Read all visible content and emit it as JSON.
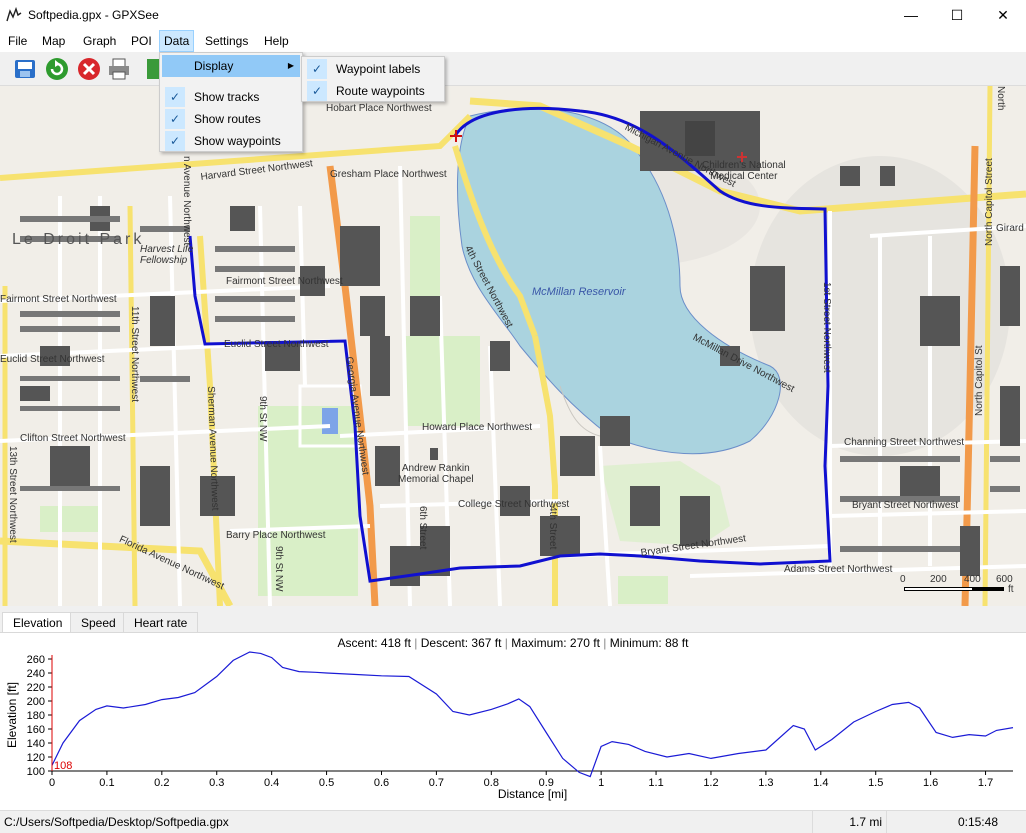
{
  "window": {
    "title": "Softpedia.gpx - GPXSee",
    "minimize": "—",
    "maximize": "☐",
    "close": "✕"
  },
  "menubar": {
    "items": [
      "File",
      "Map",
      "Graph",
      "POI",
      "Data",
      "Settings",
      "Help"
    ]
  },
  "data_menu": {
    "display_label": "Display",
    "items": [
      {
        "label": "Show tracks",
        "checked": true
      },
      {
        "label": "Show routes",
        "checked": true
      },
      {
        "label": "Show waypoints",
        "checked": true
      }
    ]
  },
  "display_submenu": {
    "items": [
      {
        "label": "Waypoint labels",
        "checked": true
      },
      {
        "label": "Route waypoints",
        "checked": true
      }
    ]
  },
  "toolbar": {
    "icons": [
      "open-icon",
      "reload-icon",
      "close-file-icon",
      "print-icon",
      "export-icon"
    ]
  },
  "map": {
    "labels": {
      "reservoir": "McMillan Reservoir",
      "hospital": "Children's National\nMedical Center",
      "chapel": "Andrew Rankin\nMemorial Chapel",
      "fellowship": "Harvest Life\nFellowship",
      "hobart": "Hobart Place Northwest",
      "harvard": "Harvard Street Northwest",
      "gresham": "Gresham Place Northwest",
      "fairmont1": "Fairmont Street Northwest",
      "fairmont2": "Fairmont Street Northwest",
      "euclid1": "Euclid Street Northwest",
      "euclid2": "Euclid Street Northwest",
      "clifton": "Clifton Street Northwest",
      "howard": "Howard Place Northwest",
      "college": "College Street Northwest",
      "barry": "Barry Place Northwest",
      "bryant1": "Bryant Street Northwest",
      "bryant2": "Bryant Street Northwest",
      "adams": "Adams Street Northwest",
      "channing": "Channing Street Northwest",
      "girard": "Girard",
      "florida": "Florida Avenue Northwest",
      "michigan": "Michigan Avenue Northwest",
      "fourth": "4th Street Northwest",
      "fourth2": "4th Street",
      "first": "1st Street Northwest",
      "ncapitol": "North Capitol Street",
      "ncap2": "North Capitol St",
      "eleventh": "11th Street Northwest",
      "thirteenth": "13th Street Northwest",
      "sherman": "Sherman Avenue Northwest",
      "georgia": "Georgia Avenue Northwest",
      "ninth": "9th St NW",
      "ninth2": "9th St NW",
      "sixth": "6th Street",
      "mcmillan_dr": "McMillan Drive Northwest",
      "lettr": "Le Droit Park",
      "north_r": "North",
      "vern": "n Avenue Northwest"
    },
    "scale": {
      "ticks": [
        "0",
        "200",
        "400",
        "600"
      ],
      "unit": "ft"
    }
  },
  "tabs": [
    {
      "label": "Elevation",
      "active": true
    },
    {
      "label": "Speed",
      "active": false
    },
    {
      "label": "Heart rate",
      "active": false
    }
  ],
  "graph": {
    "info": {
      "ascent": "Ascent: 418 ft",
      "descent": "Descent: 367 ft",
      "maximum": "Maximum: 270 ft",
      "minimum": "Minimum: 88 ft"
    },
    "marker_value": "108",
    "line_color": "#1b1bd6"
  },
  "chart_data": {
    "type": "line",
    "xlabel": "Distance [mi]",
    "ylabel": "Elevation [ft]",
    "xlim": [
      0,
      1.75
    ],
    "ylim": [
      100,
      260
    ],
    "x_ticks": [
      "0",
      "0.1",
      "0.2",
      "0.3",
      "0.4",
      "0.5",
      "0.6",
      "0.7",
      "0.8",
      "0.9",
      "1",
      "1.1",
      "1.2",
      "1.3",
      "1.4",
      "1.5",
      "1.6",
      "1.7"
    ],
    "y_ticks": [
      "100",
      "120",
      "140",
      "160",
      "180",
      "200",
      "220",
      "240",
      "260"
    ],
    "series": [
      {
        "x": [
          0,
          0.02,
          0.05,
          0.08,
          0.1,
          0.13,
          0.17,
          0.2,
          0.23,
          0.26,
          0.3,
          0.33,
          0.36,
          0.38,
          0.4,
          0.42,
          0.45,
          0.48,
          0.5,
          0.55,
          0.6,
          0.65,
          0.7,
          0.73,
          0.76,
          0.8,
          0.83,
          0.85,
          0.87,
          0.9,
          0.93,
          0.96,
          0.98,
          1.0,
          1.02,
          1.05,
          1.08,
          1.12,
          1.16,
          1.2,
          1.25,
          1.3,
          1.35,
          1.37,
          1.39,
          1.42,
          1.46,
          1.5,
          1.53,
          1.56,
          1.58,
          1.61,
          1.64,
          1.67,
          1.7,
          1.72,
          1.75
        ],
        "y": [
          108,
          140,
          172,
          188,
          193,
          190,
          195,
          202,
          205,
          212,
          235,
          258,
          270,
          268,
          262,
          248,
          242,
          241,
          240,
          238,
          236,
          235,
          210,
          185,
          180,
          188,
          196,
          203,
          192,
          155,
          118,
          98,
          92,
          135,
          142,
          138,
          128,
          120,
          125,
          118,
          125,
          130,
          165,
          160,
          130,
          145,
          170,
          185,
          195,
          198,
          190,
          155,
          148,
          152,
          150,
          158,
          162
        ]
      }
    ]
  },
  "statusbar": {
    "path": "C:/Users/Softpedia/Desktop/Softpedia.gpx",
    "distance": "1.7 mi",
    "time": "0:15:48"
  }
}
